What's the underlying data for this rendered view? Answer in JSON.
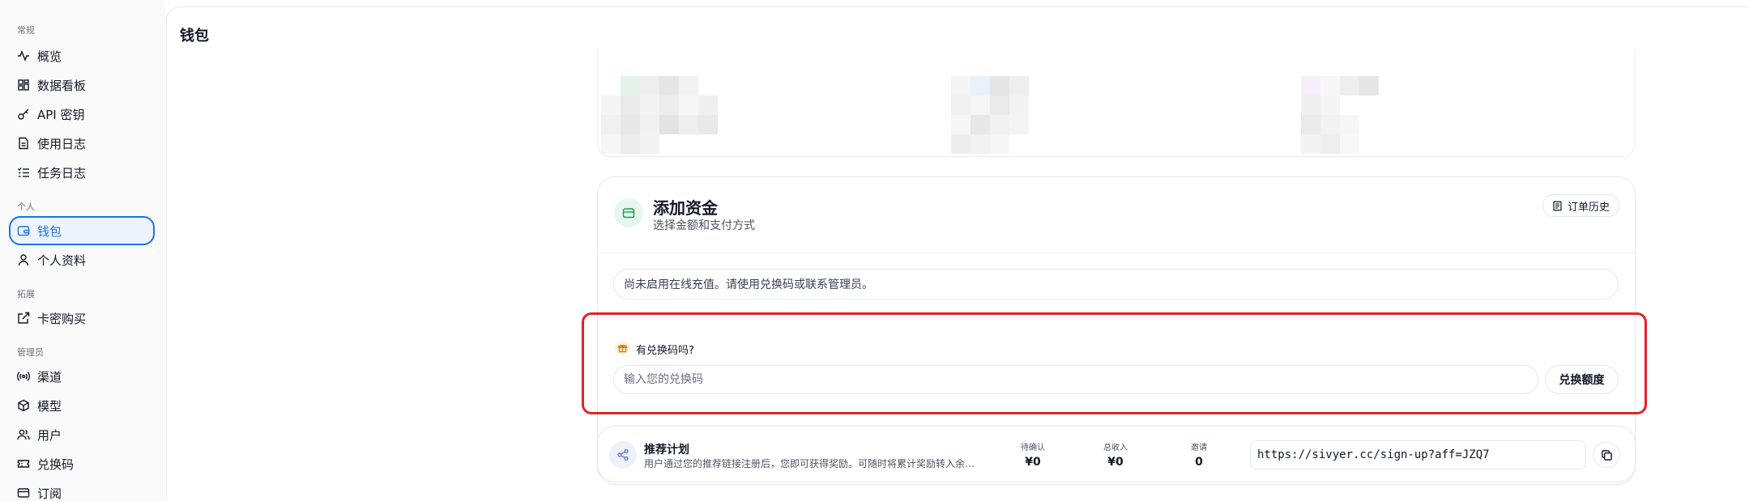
{
  "sidebar": {
    "sections": [
      {
        "label": "常规",
        "items": [
          {
            "label": "概览",
            "icon": "activity-icon"
          },
          {
            "label": "数据看板",
            "icon": "dashboard-icon"
          },
          {
            "label": "API 密钥",
            "icon": "key-icon"
          },
          {
            "label": "使用日志",
            "icon": "document-icon"
          },
          {
            "label": "任务日志",
            "icon": "task-list-icon"
          }
        ]
      },
      {
        "label": "个人",
        "items": [
          {
            "label": "钱包",
            "icon": "wallet-icon",
            "active": true
          },
          {
            "label": "个人资料",
            "icon": "user-icon"
          }
        ]
      },
      {
        "label": "拓展",
        "items": [
          {
            "label": "卡密购买",
            "icon": "external-link-icon"
          }
        ]
      },
      {
        "label": "管理员",
        "items": [
          {
            "label": "渠道",
            "icon": "broadcast-icon"
          },
          {
            "label": "模型",
            "icon": "cube-icon"
          },
          {
            "label": "用户",
            "icon": "users-icon"
          },
          {
            "label": "兑换码",
            "icon": "ticket-icon"
          },
          {
            "label": "订阅",
            "icon": "card-icon"
          }
        ]
      }
    ]
  },
  "page": {
    "title": "钱包"
  },
  "add_funds": {
    "title": "添加资金",
    "subtitle": "选择金额和支付方式",
    "history_label": "订单历史",
    "notice": "尚未启用在线充值。请使用兑换码或联系管理员。"
  },
  "redeem": {
    "question": "有兑换码吗?",
    "placeholder": "输入您的兑换码",
    "button_label": "兑换额度"
  },
  "referral": {
    "title": "推荐计划",
    "description": "用户通过您的推荐链接注册后，您即可获得奖励。可随时将累计奖励转入余…",
    "stats": [
      {
        "label": "待确认",
        "value": "¥0"
      },
      {
        "label": "总收入",
        "value": "¥0"
      },
      {
        "label": "邀请",
        "value": "0"
      }
    ],
    "link": "https://sivyer.cc/sign-up?aff=JZQ7"
  },
  "colors": {
    "accent": "#1a73e8",
    "highlight_border": "#e02424",
    "fund_icon_bg": "#e7f6ef",
    "fund_icon_fg": "#16a34a"
  }
}
